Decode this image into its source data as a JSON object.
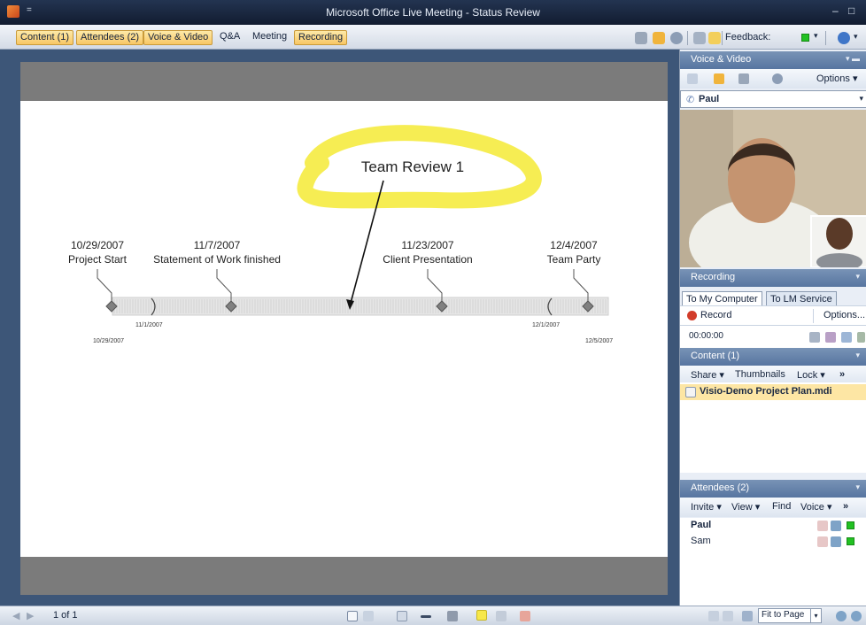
{
  "window": {
    "title": "Microsoft Office Live Meeting - Status Review",
    "quick_access": "="
  },
  "menubar": {
    "items": [
      {
        "label": "Content (1)",
        "active": true
      },
      {
        "label": "Attendees (2)",
        "active": true
      },
      {
        "label": "Voice & Video",
        "active": true
      },
      {
        "label": "Q&A",
        "active": false
      },
      {
        "label": "Meeting",
        "active": false
      },
      {
        "label": "Recording",
        "active": true
      }
    ],
    "feedback_label": "Feedback:"
  },
  "slide": {
    "annotation_title": "Team Review 1",
    "milestones": [
      {
        "date": "10/29/2007",
        "label": "Project Start"
      },
      {
        "date": "11/7/2007",
        "label": "Statement of Work finished"
      },
      {
        "date": "11/23/2007",
        "label": "Client Presentation"
      },
      {
        "date": "12/4/2007",
        "label": "Team Party"
      }
    ],
    "axis": {
      "start": "10/29/2007",
      "end": "12/5/2007",
      "inner_start": "11/1/2007",
      "inner_end": "12/1/2007"
    }
  },
  "voice_video": {
    "header": "Voice & Video",
    "options_label": "Options",
    "speaker": "Paul"
  },
  "recording": {
    "header": "Recording",
    "tab_active": "To My Computer",
    "tab_other": "To LM Service",
    "record_label": "Record",
    "options_label": "Options...",
    "time": "00:00:00"
  },
  "content_pane": {
    "header": "Content (1)",
    "toolbar": [
      "Share",
      "Thumbnails",
      "Lock"
    ],
    "file": "Visio-Demo Project Plan.mdi"
  },
  "attendees_pane": {
    "header": "Attendees (2)",
    "toolbar": [
      "Invite",
      "View",
      "Find",
      "Voice"
    ],
    "people": [
      "Paul",
      "Sam"
    ]
  },
  "statusbar": {
    "page": "1 of 1",
    "zoom_option": "Fit to Page"
  },
  "colors": {
    "highlight_yellow": "#f5ec4a",
    "menu_active": "#f8c766",
    "pane_header": "#5775a0",
    "presence_green": "#22c122"
  }
}
